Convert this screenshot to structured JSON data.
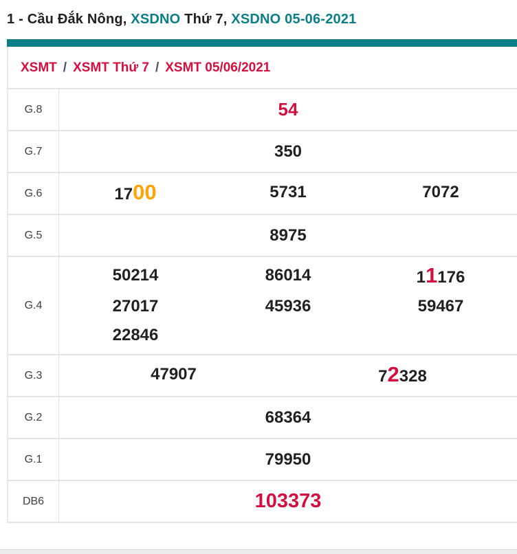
{
  "title": {
    "part1": "1 - Cầu Đắk Nông, ",
    "part2": "XSDNO",
    "part3": " Thứ 7, ",
    "part4": "XSDNO 05-06-2021"
  },
  "breadcrumb": {
    "separator": "/",
    "items": [
      "XSMT",
      "XSMT Thứ 7",
      "XSMT 05/06/2021"
    ]
  },
  "colors": {
    "teal": "#0b7d85",
    "crimson": "#d0113f",
    "orange": "#ffa502",
    "dark": "#202124",
    "border": "#e4e4e4"
  },
  "table": {
    "rows": [
      {
        "label": "G.8",
        "layout": "single",
        "values": [
          [
            {
              "t": "54",
              "s": "crimson"
            }
          ]
        ]
      },
      {
        "label": "G.7",
        "layout": "single",
        "values": [
          [
            {
              "t": "350"
            }
          ]
        ]
      },
      {
        "label": "G.6",
        "layout": "cols3",
        "values": [
          [
            {
              "t": "17"
            },
            {
              "t": "00",
              "s": "orange-big"
            }
          ],
          [
            {
              "t": "5731"
            }
          ],
          [
            {
              "t": "7072"
            }
          ]
        ]
      },
      {
        "label": "G.5",
        "layout": "single",
        "values": [
          [
            {
              "t": "8975"
            }
          ]
        ]
      },
      {
        "label": "G.4",
        "layout": "cols3",
        "values": [
          [
            {
              "t": "50214"
            }
          ],
          [
            {
              "t": "86014"
            }
          ],
          [
            {
              "t": "1"
            },
            {
              "t": "1",
              "s": "crimson-big"
            },
            {
              "t": "176"
            }
          ],
          [
            {
              "t": "27017"
            }
          ],
          [
            {
              "t": "45936"
            }
          ],
          [
            {
              "t": "59467"
            }
          ],
          [
            {
              "t": "22846"
            }
          ]
        ]
      },
      {
        "label": "G.3",
        "layout": "cols2",
        "values": [
          [
            {
              "t": "47907"
            }
          ],
          [
            {
              "t": "7"
            },
            {
              "t": "2",
              "s": "crimson-big"
            },
            {
              "t": "328"
            }
          ]
        ]
      },
      {
        "label": "G.2",
        "layout": "single",
        "values": [
          [
            {
              "t": "68364"
            }
          ]
        ]
      },
      {
        "label": "G.1",
        "layout": "single",
        "values": [
          [
            {
              "t": "79950"
            }
          ]
        ]
      },
      {
        "label": "DB6",
        "layout": "single",
        "values": [
          [
            {
              "t": "103373",
              "s": "crimson-db"
            }
          ]
        ]
      }
    ]
  }
}
